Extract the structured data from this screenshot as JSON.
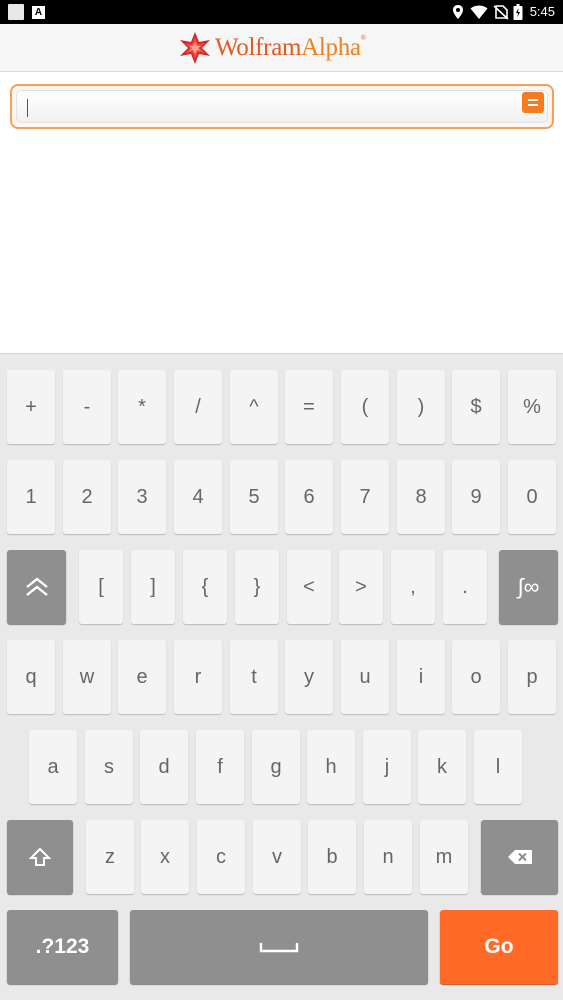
{
  "status_bar": {
    "time": "5:45",
    "left_icons": [
      "square-icon",
      "a-icon"
    ],
    "right_icons": [
      "location-icon",
      "wifi-icon",
      "no-sim-icon",
      "battery-icon"
    ]
  },
  "header": {
    "logo_word1": "Wolfram",
    "logo_word2": "Alpha",
    "logo_mark": "®"
  },
  "search": {
    "value": "",
    "placeholder": "",
    "submit_icon": "equals-icon"
  },
  "keyboard": {
    "row1": [
      "+",
      "-",
      "*",
      "/",
      "^",
      "=",
      "(",
      ")",
      "$",
      "%"
    ],
    "row2": [
      "1",
      "2",
      "3",
      "4",
      "5",
      "6",
      "7",
      "8",
      "9",
      "0"
    ],
    "row3_toggle_icon": "double-chevron-up-icon",
    "row3": [
      "[",
      "]",
      "{",
      "}",
      "<",
      ">",
      ",",
      "."
    ],
    "row3_math_key": "∫∞",
    "row4": [
      "q",
      "w",
      "e",
      "r",
      "t",
      "y",
      "u",
      "i",
      "o",
      "p"
    ],
    "row5": [
      "a",
      "s",
      "d",
      "f",
      "g",
      "h",
      "j",
      "k",
      "l"
    ],
    "row6": [
      "z",
      "x",
      "c",
      "v",
      "b",
      "n",
      "m"
    ],
    "shift_icon": "shift-arrow-icon",
    "backspace_icon": "backspace-icon",
    "mode_key": ".?123",
    "space_icon": "space-bar-icon",
    "go_key": "Go",
    "colors": {
      "accent": "#ff6a26",
      "key_bg": "#f4f4f4",
      "special_key_bg": "#8f8f8f",
      "keyboard_bg": "#e9e9e9"
    }
  }
}
